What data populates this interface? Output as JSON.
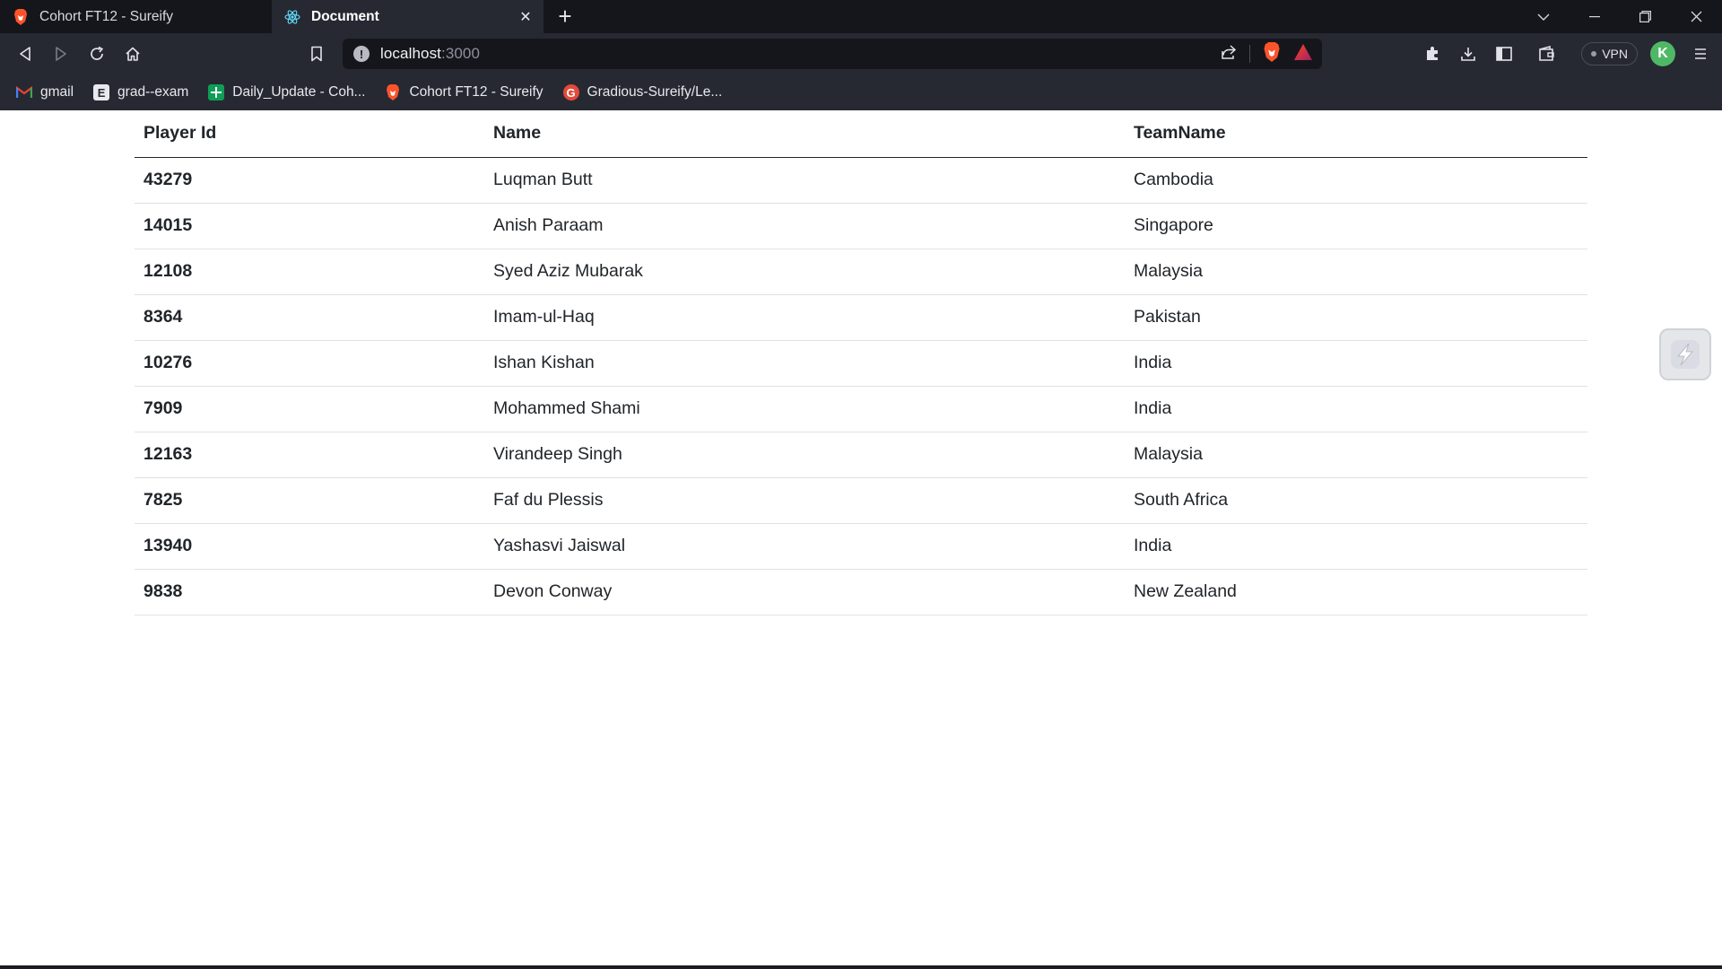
{
  "browser": {
    "tabs": [
      {
        "title": "Cohort FT12 - Sureify",
        "icon": "brave-lion-icon",
        "active": false
      },
      {
        "title": "Document",
        "icon": "react-icon",
        "active": true
      }
    ],
    "address": {
      "host": "localhost",
      "port": ":3000"
    },
    "vpn_label": "VPN",
    "profile_initial": "K",
    "bookmarks": [
      {
        "label": "gmail",
        "icon": "gmail-icon"
      },
      {
        "label": "grad--exam",
        "icon": "forms-icon"
      },
      {
        "label": "Daily_Update - Coh...",
        "icon": "sheets-icon"
      },
      {
        "label": "Cohort FT12 - Sureify",
        "icon": "brave-lion-icon"
      },
      {
        "label": "Gradious-Sureify/Le...",
        "icon": "gradious-icon"
      }
    ]
  },
  "table": {
    "headers": {
      "id": "Player Id",
      "name": "Name",
      "team": "TeamName"
    },
    "rows": [
      {
        "id": "43279",
        "name": "Luqman Butt",
        "team": "Cambodia"
      },
      {
        "id": "14015",
        "name": "Anish Paraam",
        "team": "Singapore"
      },
      {
        "id": "12108",
        "name": "Syed Aziz Mubarak",
        "team": "Malaysia"
      },
      {
        "id": "8364",
        "name": "Imam-ul-Haq",
        "team": "Pakistan"
      },
      {
        "id": "10276",
        "name": "Ishan Kishan",
        "team": "India"
      },
      {
        "id": "7909",
        "name": "Mohammed Shami",
        "team": "India"
      },
      {
        "id": "12163",
        "name": "Virandeep Singh",
        "team": "Malaysia"
      },
      {
        "id": "7825",
        "name": "Faf du Plessis",
        "team": "South Africa"
      },
      {
        "id": "13940",
        "name": "Yashasvi Jaiswal",
        "team": "India"
      },
      {
        "id": "9838",
        "name": "Devon Conway",
        "team": "New Zealand"
      }
    ]
  },
  "colors": {
    "tab_bar": "#15161c",
    "toolbar": "#272932",
    "brave_orange": "#fb542b"
  }
}
